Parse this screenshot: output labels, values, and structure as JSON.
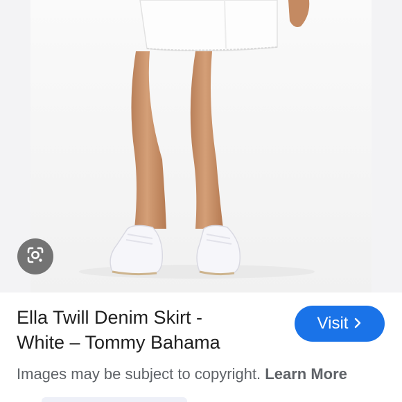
{
  "product": {
    "title_line1": "Ella Twill Denim Skirt -",
    "title_line2": "White – Tommy Bahama"
  },
  "visit_button": {
    "label": "Visit",
    "icon": "chevron-right-icon"
  },
  "lens_button": {
    "icon": "lens-camera-icon"
  },
  "notice": {
    "text": "Images may be subject to copyright.",
    "link_label": "Learn More"
  },
  "colors": {
    "accent": "#1a73e8",
    "text_primary": "#1f1f1f",
    "text_secondary": "#5f6368",
    "image_background": "#f3f3f5"
  }
}
